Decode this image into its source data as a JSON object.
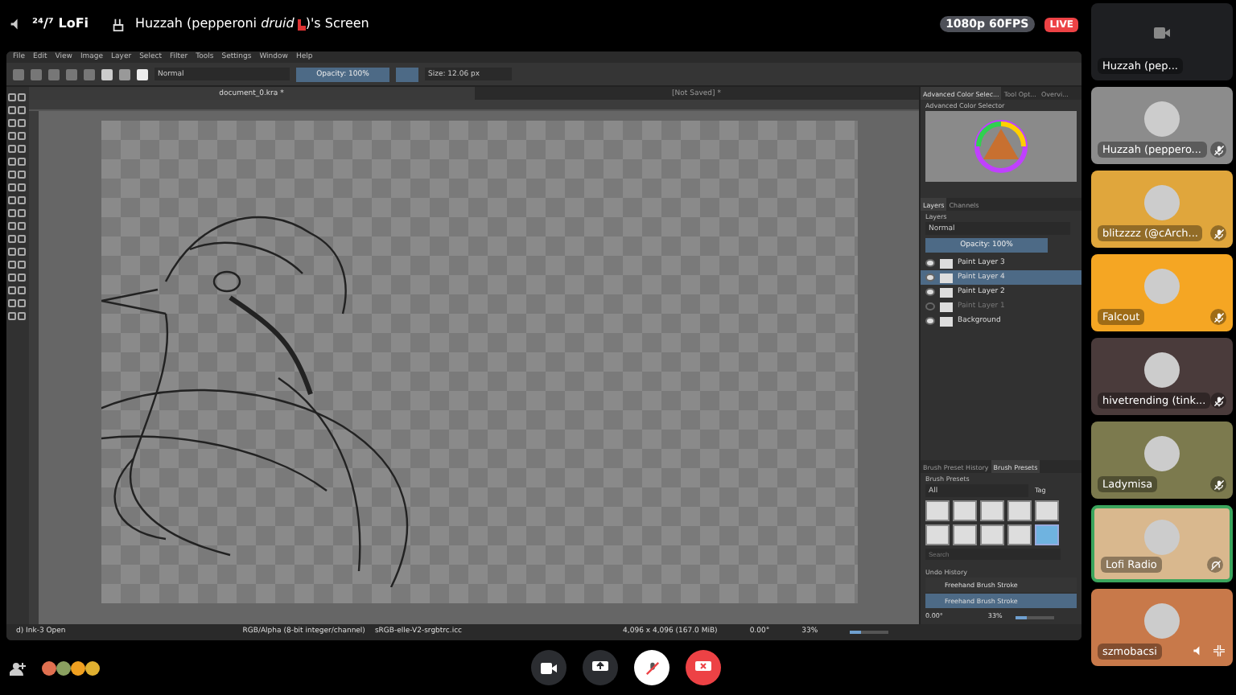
{
  "header": {
    "channel": "²⁴/⁷ LoFi",
    "title": "Huzzah (pepperoni *druid*",
    "title_suffix": ")'s Screen",
    "quality": "1080p 60FPS",
    "live": "LIVE"
  },
  "krita": {
    "menu": [
      "File",
      "Edit",
      "View",
      "Image",
      "Layer",
      "Select",
      "Filter",
      "Tools",
      "Settings",
      "Window",
      "Help"
    ],
    "toolbar": {
      "blend_mode": "Normal",
      "opacity": "Opacity: 100%",
      "size": "Size: 12.06 px"
    },
    "documents": [
      {
        "title": "document_0.kra *",
        "selected": true
      },
      {
        "title": "[Not Saved] *",
        "selected": false
      }
    ],
    "color_tabs": [
      {
        "label": "Advanced Color Selec...",
        "selected": true
      },
      {
        "label": "Tool Opt...",
        "selected": false
      },
      {
        "label": "Overvi...",
        "selected": false
      }
    ],
    "color_title": "Advanced Color Selector",
    "layer_tabs": [
      {
        "label": "Layers",
        "selected": true
      },
      {
        "label": "Channels",
        "selected": false
      }
    ],
    "layers_title": "Layers",
    "layer_blend": "Normal",
    "layer_opacity": "Opacity:  100%",
    "layers": [
      {
        "name": "Paint Layer 3",
        "selected": false,
        "visible": true
      },
      {
        "name": "Paint Layer 4",
        "selected": true,
        "visible": true
      },
      {
        "name": "Paint Layer 2",
        "selected": false,
        "visible": true
      },
      {
        "name": "Paint Layer 1",
        "selected": false,
        "visible": false
      },
      {
        "name": "Background",
        "selected": false,
        "visible": true
      }
    ],
    "brush_tabs": [
      {
        "label": "Brush Preset History",
        "selected": false
      },
      {
        "label": "Brush Presets",
        "selected": true
      }
    ],
    "brush_title": "Brush Presets",
    "brush_filter": "All",
    "tag": "Tag",
    "search_placeholder": "Search",
    "brush_presets": [
      {
        "selected": false
      },
      {
        "selected": false
      },
      {
        "selected": false
      },
      {
        "selected": false
      },
      {
        "selected": false
      },
      {
        "selected": false
      },
      {
        "selected": false
      },
      {
        "selected": false
      },
      {
        "selected": false
      },
      {
        "selected": true
      }
    ],
    "undo_title": "Undo History",
    "undo": [
      {
        "label": "Freehand Brush Stroke",
        "selected": false
      },
      {
        "label": "Freehand Brush Stroke",
        "selected": true
      }
    ],
    "rotation": "0.00°",
    "zoom": "33%",
    "zoom_slider": {
      "level": 0.3
    },
    "status": {
      "brush": "d) Ink-3 Open",
      "color_space": "RGB/Alpha (8-bit integer/channel)",
      "profile": "sRGB-elle-V2-srgbtrc.icc",
      "size": "4,096 x 4,096 (167.0 MiB)",
      "rotation": "0.00°",
      "zoom": "33%",
      "zoom_slider": {
        "level": 0.3
      }
    }
  },
  "participants": [
    {
      "kind": "stream",
      "name": "Huzzah (pep...",
      "color": "#1e1f22",
      "muted": false,
      "deafened": false,
      "hovered": false,
      "speaking": false
    },
    {
      "kind": "user",
      "name": "Huzzah (peppero...",
      "color": "#8c8c8c",
      "muted": true,
      "deafened": false,
      "hovered": false,
      "speaking": false
    },
    {
      "kind": "user",
      "name": "blitzzzz (@cArch...",
      "color": "#e0a63c",
      "muted": true,
      "deafened": false,
      "hovered": false,
      "speaking": false
    },
    {
      "kind": "user",
      "name": "Falcout",
      "color": "#f5a623",
      "muted": true,
      "deafened": false,
      "hovered": false,
      "speaking": false
    },
    {
      "kind": "user",
      "name": "hivetrending (tink...",
      "color": "#4a3b3b",
      "muted": true,
      "deafened": false,
      "hovered": false,
      "speaking": false
    },
    {
      "kind": "user",
      "name": "Ladymisa",
      "color": "#7c7a4e",
      "muted": true,
      "deafened": false,
      "hovered": false,
      "speaking": false
    },
    {
      "kind": "user",
      "name": "Lofi Radio",
      "color": "#d9b88e",
      "muted": false,
      "deafened": true,
      "hovered": false,
      "speaking": true
    },
    {
      "kind": "user",
      "name": "szmobacsi",
      "color": "#c8794a",
      "muted": false,
      "deafened": false,
      "hovered": true,
      "speaking": false
    }
  ],
  "controls": {
    "camera_on": false,
    "mic_muted": true
  }
}
